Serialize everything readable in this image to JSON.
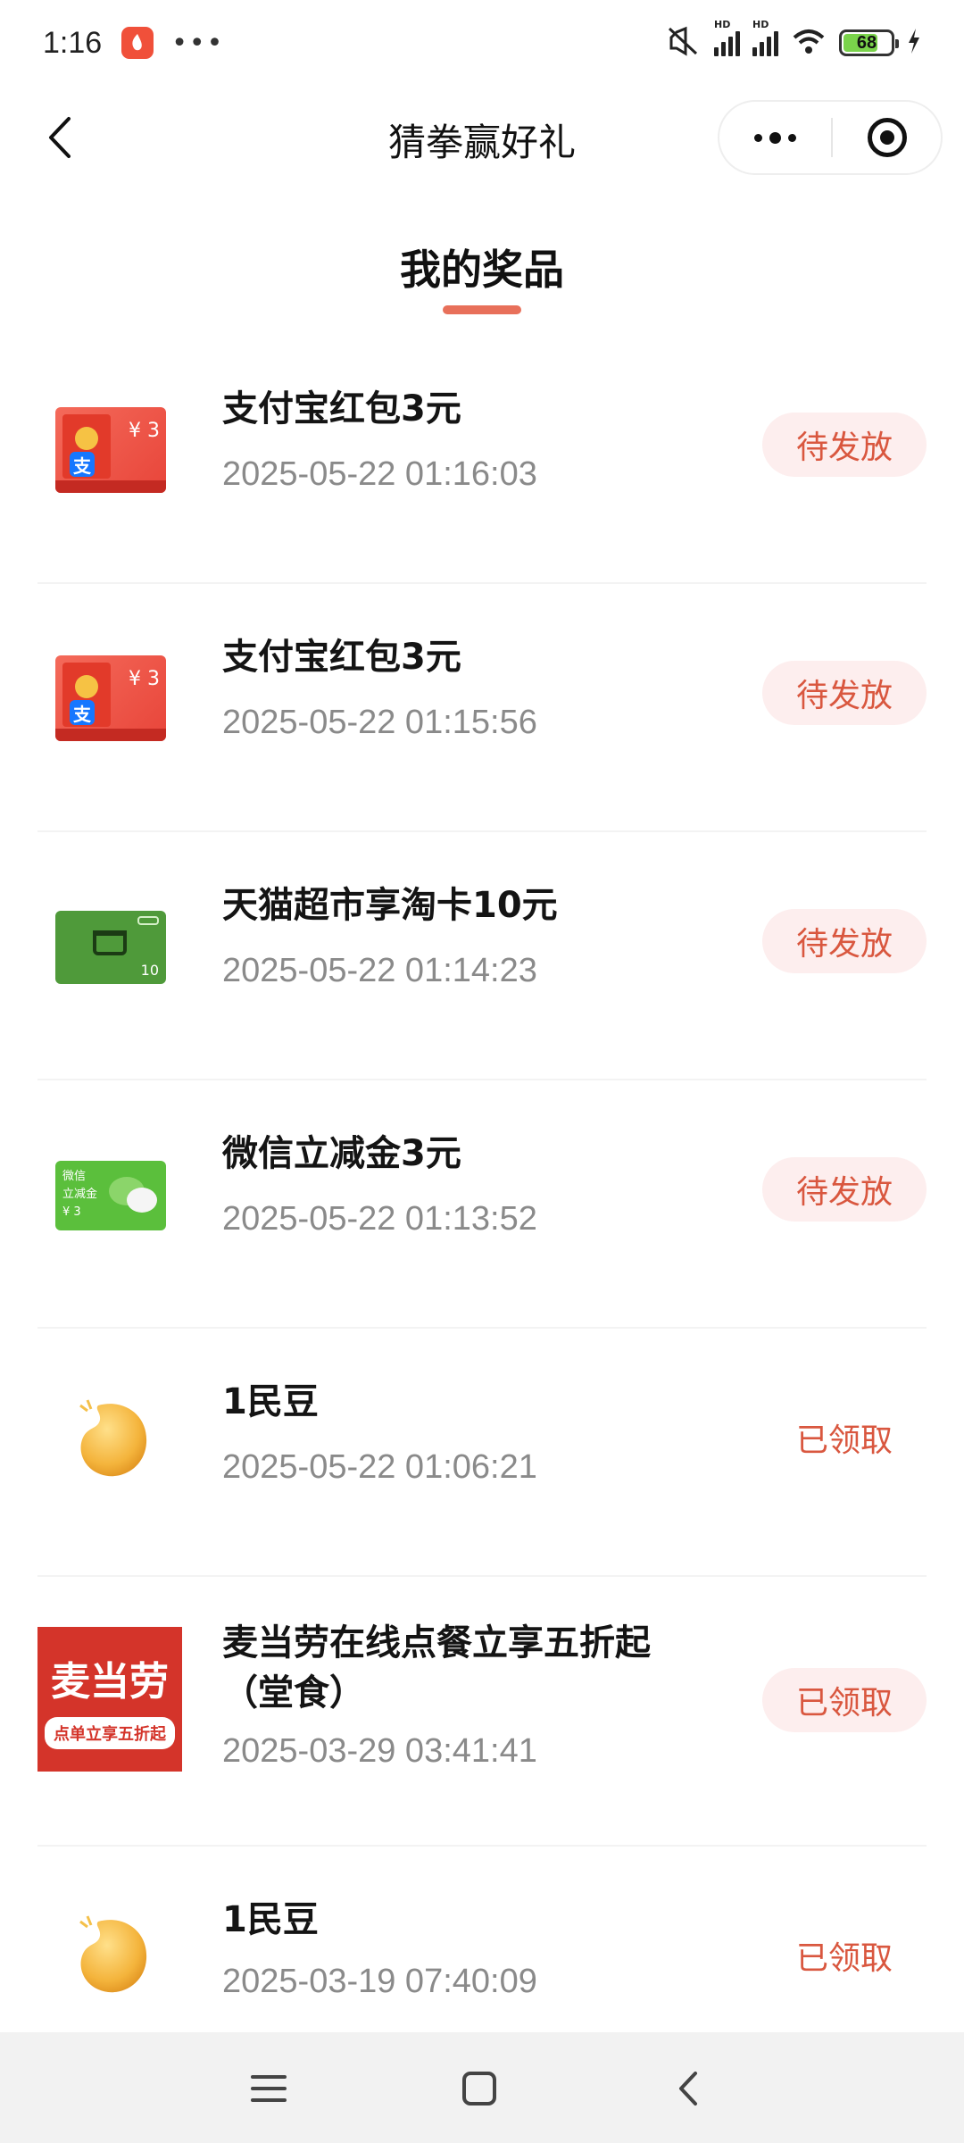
{
  "status_bar": {
    "time": "1:16",
    "battery": "68",
    "signal_label": "HD"
  },
  "nav": {
    "title": "猜拳赢好礼"
  },
  "section": {
    "title": "我的奖品"
  },
  "prizes": [
    {
      "name": "支付宝红包3元",
      "time": "2025-05-22 01:16:03",
      "status": "待发放",
      "thumb": "alipay-red-packet",
      "thumb_amount": "¥ 3"
    },
    {
      "name": "支付宝红包3元",
      "time": "2025-05-22 01:15:56",
      "status": "待发放",
      "thumb": "alipay-red-packet",
      "thumb_amount": "¥ 3"
    },
    {
      "name": "天猫超市享淘卡10元",
      "time": "2025-05-22 01:14:23",
      "status": "待发放",
      "thumb": "tmall-card",
      "thumb_amount": "10"
    },
    {
      "name": "微信立减金3元",
      "time": "2025-05-22 01:13:52",
      "status": "待发放",
      "thumb": "wechat-voucher",
      "thumb_text_1": "微信",
      "thumb_text_2": "立减金",
      "thumb_amount": "¥ 3"
    },
    {
      "name": "1民豆",
      "time": "2025-05-22 01:06:21",
      "status": "已领取",
      "thumb": "bean"
    },
    {
      "name_line1": "麦当劳在线点餐立享五折起",
      "name_line2": "（堂食）",
      "time": "2025-03-29 03:41:41",
      "status": "已领取",
      "thumb": "mcdonalds",
      "thumb_title": "麦当劳",
      "thumb_sub": "点单立享五折起"
    },
    {
      "name": "1民豆",
      "time": "2025-03-19 07:40:09",
      "status": "已领取",
      "thumb": "bean"
    }
  ],
  "colors": {
    "accent": "#e8705a",
    "status_text": "#d9573f",
    "status_pill_bg": "#fdeeee",
    "time_text": "#8a8a8a"
  },
  "icons": {
    "back": "back-arrow-icon",
    "more": "more-dots-icon",
    "close": "miniprogram-close-icon",
    "menu": "menu-lines-icon",
    "home": "home-square-icon",
    "sys_back": "system-back-icon"
  }
}
